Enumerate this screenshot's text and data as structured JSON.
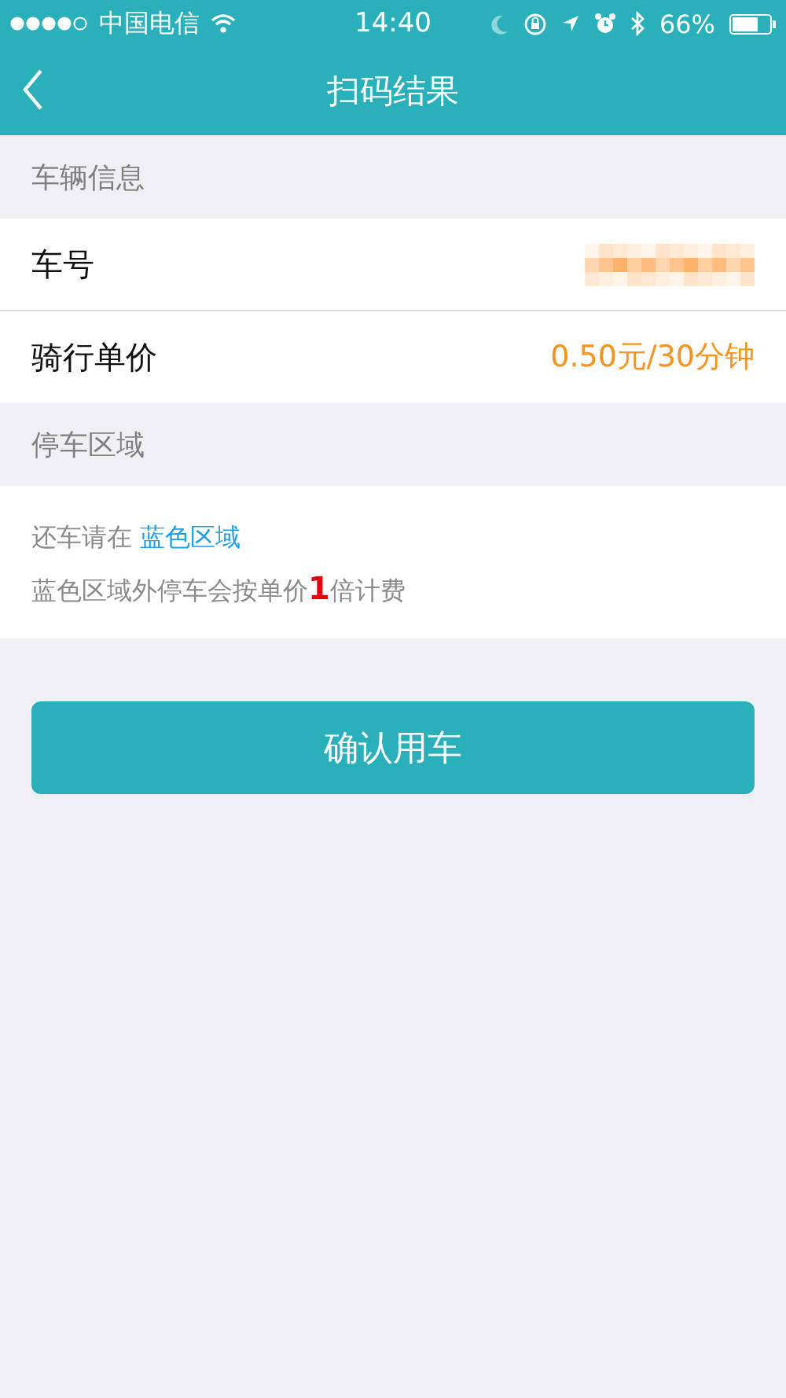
{
  "status_bar": {
    "carrier": "中国电信",
    "time": "14:40",
    "battery": "66%"
  },
  "nav": {
    "title": "扫码结果"
  },
  "vehicle_section": {
    "heading": "车辆信息",
    "rows": [
      {
        "label": "车号",
        "kind": "hidden"
      },
      {
        "label": "骑行单价",
        "kind": "text",
        "value": "0.50元/30分钟"
      }
    ]
  },
  "parking_section": {
    "heading": "停车区域",
    "lines": [
      [
        {
          "text": "还车请在 ",
          "kind": "plain"
        },
        {
          "text": "蓝色区域",
          "kind": "highlight"
        }
      ],
      [
        {
          "text": "蓝色区域外停车会按单价",
          "kind": "plain"
        },
        {
          "text": "1",
          "kind": "number"
        },
        {
          "text": "倍计费",
          "kind": "plain"
        }
      ]
    ]
  },
  "confirm_button": "确认用车"
}
